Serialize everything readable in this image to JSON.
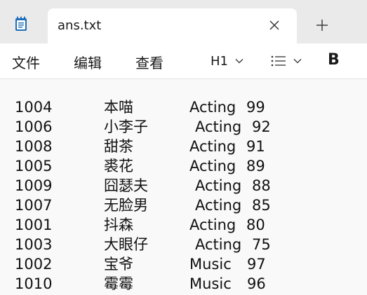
{
  "tab": {
    "title": "ans.txt"
  },
  "icons": {
    "app": "notepad-icon",
    "close": "close-icon",
    "new_tab": "plus-icon",
    "heading_chevron": "chevron-down-icon",
    "list": "list-icon",
    "list_chevron": "chevron-down-icon"
  },
  "menu": {
    "file": "文件",
    "edit": "编辑",
    "view": "查看"
  },
  "toolbar": {
    "heading": "H1",
    "bold": "B"
  },
  "colors": {
    "titlebar": "#eaeaea",
    "tab": "#ffffff",
    "editor": "#f9f9f9",
    "app_icon": "#1f6fb8"
  },
  "rows": [
    {
      "id": "1004",
      "name": "本喵",
      "dept": "Acting",
      "score": "99"
    },
    {
      "id": "1006",
      "name": "小李子",
      "dept": "Acting",
      "score": "92"
    },
    {
      "id": "1008",
      "name": "甜茶",
      "dept": "Acting",
      "score": "91"
    },
    {
      "id": "1005",
      "name": "裘花",
      "dept": "Acting",
      "score": "89"
    },
    {
      "id": "1009",
      "name": "囧瑟夫",
      "dept": "Acting",
      "score": "88"
    },
    {
      "id": "1007",
      "name": "无脸男",
      "dept": "Acting",
      "score": "85"
    },
    {
      "id": "1001",
      "name": "抖森",
      "dept": "Acting",
      "score": "80"
    },
    {
      "id": "1003",
      "name": "大眼仔",
      "dept": "Acting",
      "score": "75"
    },
    {
      "id": "1002",
      "name": "宝爷",
      "dept": "Music",
      "score": "97"
    },
    {
      "id": "1010",
      "name": "霉霉",
      "dept": "Music",
      "score": "96"
    }
  ]
}
